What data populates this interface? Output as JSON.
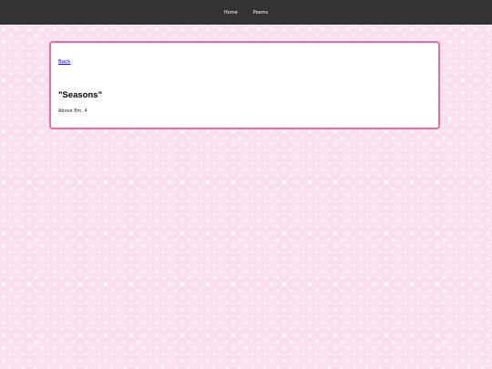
{
  "nav": {
    "items": [
      {
        "label": "Home"
      },
      {
        "label": "Poems"
      }
    ]
  },
  "post": {
    "back_label": "Back",
    "title": "\"Seasons\"",
    "meta": "Above 8m, 4"
  },
  "colors": {
    "topbar": "#333333",
    "background": "#fbe1ef",
    "card_border": "#e86ca8",
    "link": "#0000ee"
  }
}
